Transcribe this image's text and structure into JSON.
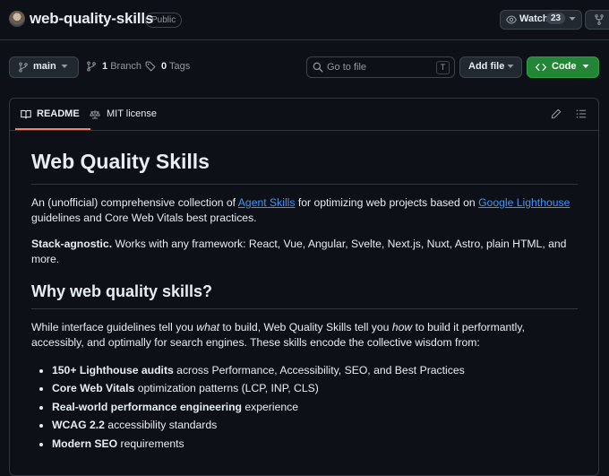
{
  "repo": {
    "name": "web-quality-skills",
    "visibility": "Public",
    "watch_label": "Watch",
    "watch_count": "23"
  },
  "toolbar": {
    "branch": "main",
    "branch_count": "1",
    "branch_label": "Branch",
    "tag_count": "0",
    "tag_label": "Tags",
    "goto_placeholder": "Go to file",
    "goto_shortcut": "T",
    "add_file_label": "Add file",
    "code_label": "Code"
  },
  "readme": {
    "tabs": [
      {
        "label": "README"
      },
      {
        "label": "MIT license"
      }
    ],
    "title": "Web Quality Skills",
    "intro": {
      "t1": "An (unofficial) comprehensive collection of ",
      "link1": "Agent Skills",
      "t2": " for optimizing web projects based on ",
      "link2": "Google Lighthouse",
      "t3": " guidelines and Core Web Vitals best practices."
    },
    "stack": {
      "strong": "Stack-agnostic.",
      "text": " Works with any framework: React, Vue, Angular, Svelte, Next.js, Nuxt, Astro, plain HTML, and more."
    },
    "h2": "Why web quality skills?",
    "why": {
      "t1": "While interface guidelines tell you ",
      "em1": "what",
      "t2": " to build, Web Quality Skills tell you ",
      "em2": "how",
      "t3": " to build it performantly, accessibly, and optimally for search engines. These skills encode the collective wisdom from:"
    },
    "list": [
      {
        "strong": "150+ Lighthouse audits",
        "text": " across Performance, Accessibility, SEO, and Best Practices"
      },
      {
        "strong": "Core Web Vitals",
        "text": " optimization patterns (LCP, INP, CLS)"
      },
      {
        "strong": "Real-world performance engineering",
        "text": " experience"
      },
      {
        "strong": "WCAG 2.2",
        "text": " accessibility standards"
      },
      {
        "strong": "Modern SEO",
        "text": " requirements"
      }
    ]
  },
  "colors": {
    "background": "#0d1117",
    "border": "#30363d",
    "link": "#4493f8",
    "code_button": "#238636",
    "tab_underline": "#f78166"
  }
}
